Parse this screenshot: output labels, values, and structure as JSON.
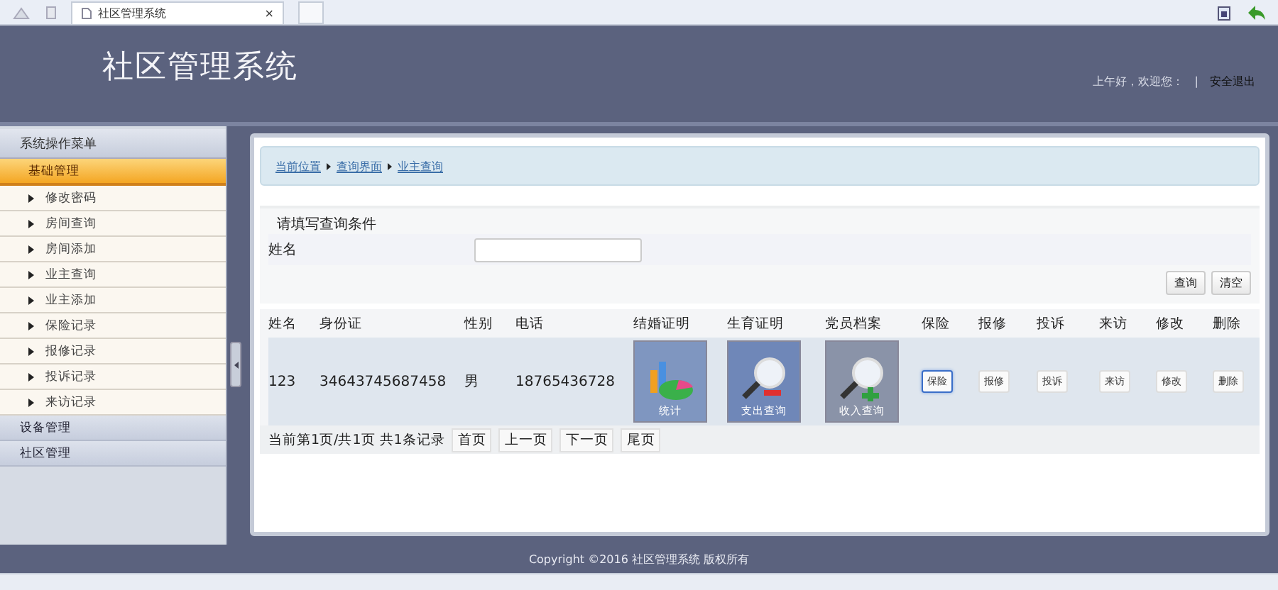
{
  "browser_tab": {
    "title": "社区管理系统",
    "close": "×"
  },
  "header": {
    "title": "社区管理系统",
    "greeting": "上午好，欢迎您：",
    "separator": "|",
    "logout": "安全退出"
  },
  "sidebar": {
    "title": "系统操作菜单",
    "groups": [
      {
        "label": "基础管理",
        "expanded": true,
        "children": [
          {
            "label": "修改密码"
          },
          {
            "label": "房间查询"
          },
          {
            "label": "房间添加"
          },
          {
            "label": "业主查询"
          },
          {
            "label": "业主添加"
          },
          {
            "label": "保险记录"
          },
          {
            "label": "报修记录"
          },
          {
            "label": "投诉记录"
          },
          {
            "label": "来访记录"
          }
        ]
      },
      {
        "label": "设备管理",
        "expanded": false
      },
      {
        "label": "社区管理",
        "expanded": false
      }
    ]
  },
  "breadcrumb": [
    "当前位置",
    "查询界面",
    "业主查询"
  ],
  "query": {
    "heading": "请填写查询条件",
    "fields": [
      {
        "label": "姓名"
      }
    ],
    "buttons": [
      "查询",
      "清空"
    ]
  },
  "table": {
    "columns": [
      "姓名",
      "身份证",
      "性别",
      "电话",
      "结婚证明",
      "生育证明",
      "党员档案",
      "保险",
      "报修",
      "投诉",
      "来访",
      "修改",
      "删除"
    ],
    "rows": [
      {
        "cells": [
          {
            "kind": "text",
            "text": "123"
          },
          {
            "kind": "text",
            "text": "34643745687458"
          },
          {
            "kind": "text",
            "text": "男"
          },
          {
            "kind": "text",
            "text": "18765436728"
          },
          {
            "kind": "chart",
            "caption": "统计"
          },
          {
            "kind": "expense",
            "caption": "支出查询"
          },
          {
            "kind": "income",
            "caption": "收入查询"
          },
          {
            "kind": "button",
            "text": "保险",
            "hovered": true
          },
          {
            "kind": "button",
            "text": "报修",
            "hovered": false
          },
          {
            "kind": "button",
            "text": "投诉",
            "hovered": false
          },
          {
            "kind": "button",
            "text": "来访",
            "hovered": false
          },
          {
            "kind": "button",
            "text": "修改",
            "hovered": false
          },
          {
            "kind": "button",
            "text": "删除",
            "hovered": false
          }
        ]
      }
    ]
  },
  "pagination": {
    "status": "当前第1页/共1页 共1条记录",
    "buttons": [
      "首页",
      "上一页",
      "下一页",
      "尾页"
    ]
  },
  "footer": "Copyright ©2016 社区管理系统 版权所有"
}
